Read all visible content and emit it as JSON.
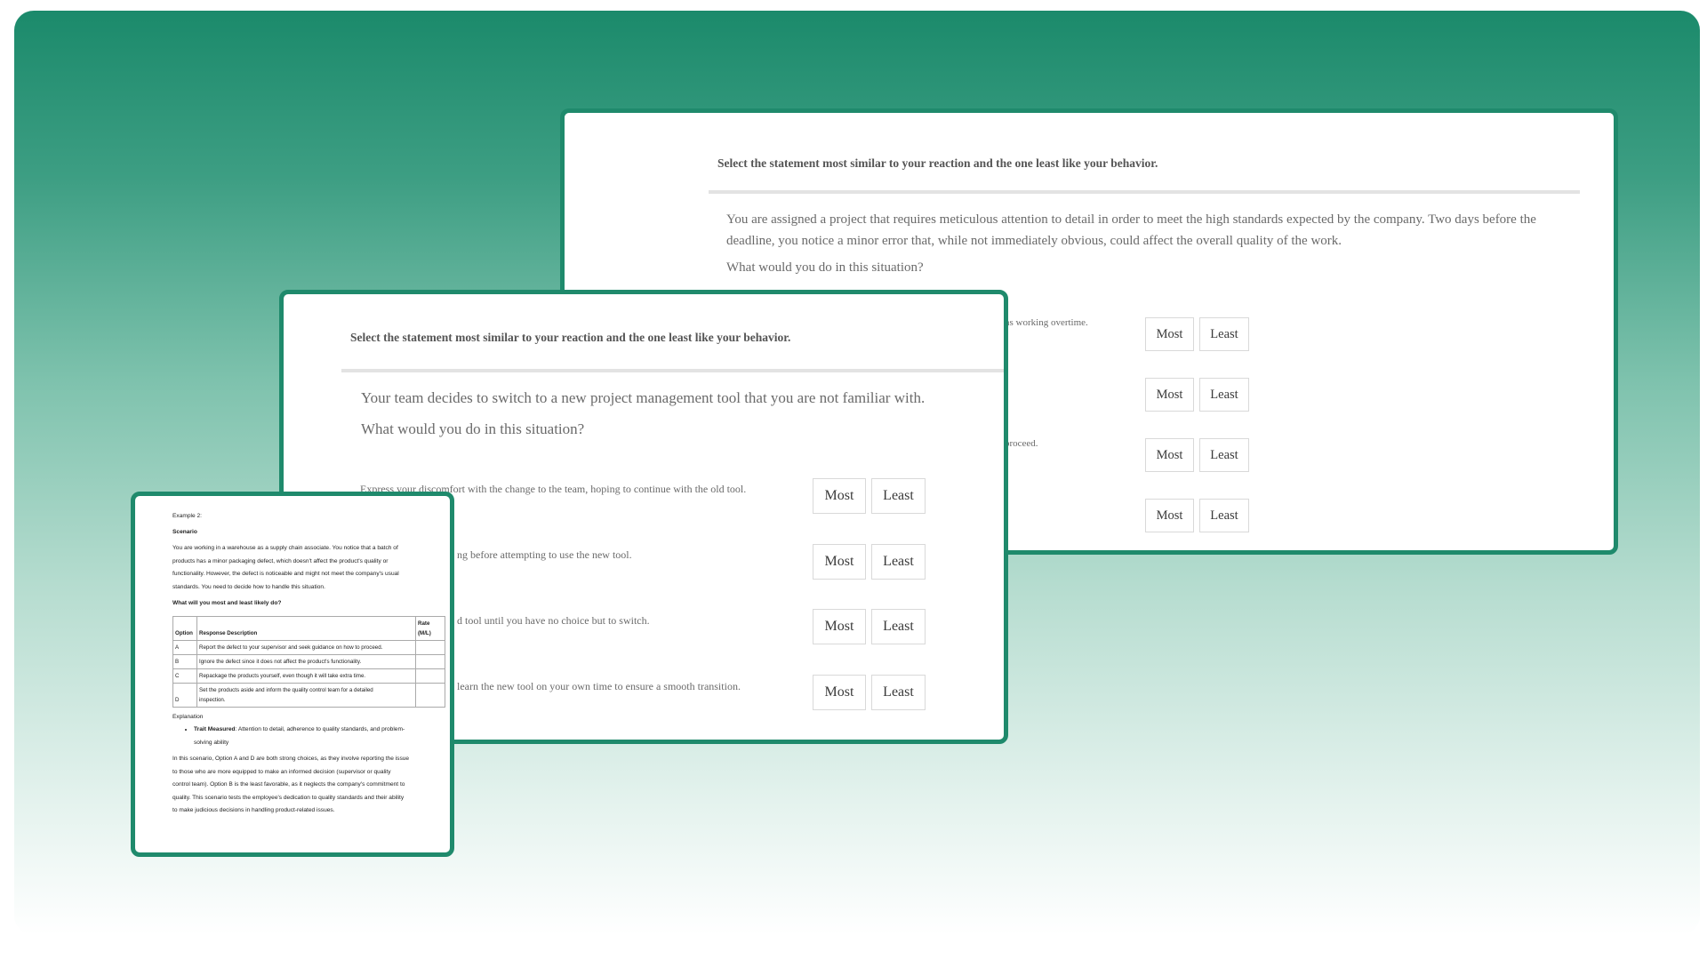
{
  "back_card": {
    "instruction": "Select the statement most similar to your reaction and the one least like your behavior.",
    "scenario": "You are assigned a project that requires meticulous attention to detail in order to meet the high standards expected by the company. Two days before the deadline, you notice a minor error that, while not immediately obvious, could affect the overall quality of the work.",
    "question": "What would you do in this situation?",
    "options": [
      {
        "text": "ns working overtime.",
        "most": "Most",
        "least": "Least"
      },
      {
        "text": "",
        "most": "Most",
        "least": "Least"
      },
      {
        "text": "proceed.",
        "most": "Most",
        "least": "Least"
      },
      {
        "text": "",
        "most": "Most",
        "least": "Least"
      }
    ]
  },
  "front_card": {
    "instruction": "Select the statement most similar to your reaction and the one least like your behavior.",
    "scenario": "Your team decides to switch to a new project management tool that you are not familiar with.",
    "question": "What would you do in this situation?",
    "options": [
      {
        "text": "Express your discomfort with the change to the team, hoping to continue with the old tool.",
        "most": "Most",
        "least": "Least"
      },
      {
        "text": "ng before attempting to use the new tool.",
        "most": "Most",
        "least": "Least"
      },
      {
        "text": "d tool until you have no choice but to switch.",
        "most": "Most",
        "least": "Least"
      },
      {
        "text": "learn the new tool on your own time to ensure a smooth transition.",
        "most": "Most",
        "least": "Least"
      }
    ]
  },
  "doc_card": {
    "example": "Example 2:",
    "scenario_heading": "Scenario",
    "scenario_lines": [
      "You are working in a warehouse as a supply chain associate. You notice that a batch of",
      "products has a minor packaging defect, which doesn't affect the product's quality or",
      "functionality. However, the defect is noticeable and might not meet the company's usual",
      "standards. You need to decide how to handle this situation."
    ],
    "question": "What will you most and least likely do?",
    "table_headers": {
      "option": "Option",
      "response": "Response Description",
      "rate_line1": "Rate",
      "rate_line2": "(M/L)"
    },
    "rows": [
      {
        "option": "A",
        "desc": [
          "Report the defect to your supervisor and seek guidance on how to proceed."
        ]
      },
      {
        "option": "B",
        "desc": [
          "Ignore the defect since it does not affect the product's functionality."
        ]
      },
      {
        "option": "C",
        "desc": [
          "Repackage the products yourself, even though it will take extra time."
        ]
      },
      {
        "option": "D",
        "desc": [
          "Set the products aside and inform the quality control team for a detailed",
          "inspection."
        ]
      }
    ],
    "explanation_heading": "Explanation",
    "trait_label": "Trait Measured",
    "trait_lines": [
      ": Attention to detail, adherence to quality standards, and problem-",
      "solving ability"
    ],
    "explanation_lines": [
      "In this scenario, Option A and D are both strong choices, as they involve reporting the issue",
      "to those who are more equipped to make an informed decision (supervisor or quality",
      "control team). Option B is the least favorable, as it neglects the company's commitment to",
      "quality. This scenario tests the employee's dedication to quality standards and their ability",
      "to make judicious decisions in handling product-related issues."
    ]
  },
  "colors": {
    "accent": "#1f8a6c",
    "gradient_top": "#1b8a6b",
    "gradient_bottom": "#ffffff"
  }
}
